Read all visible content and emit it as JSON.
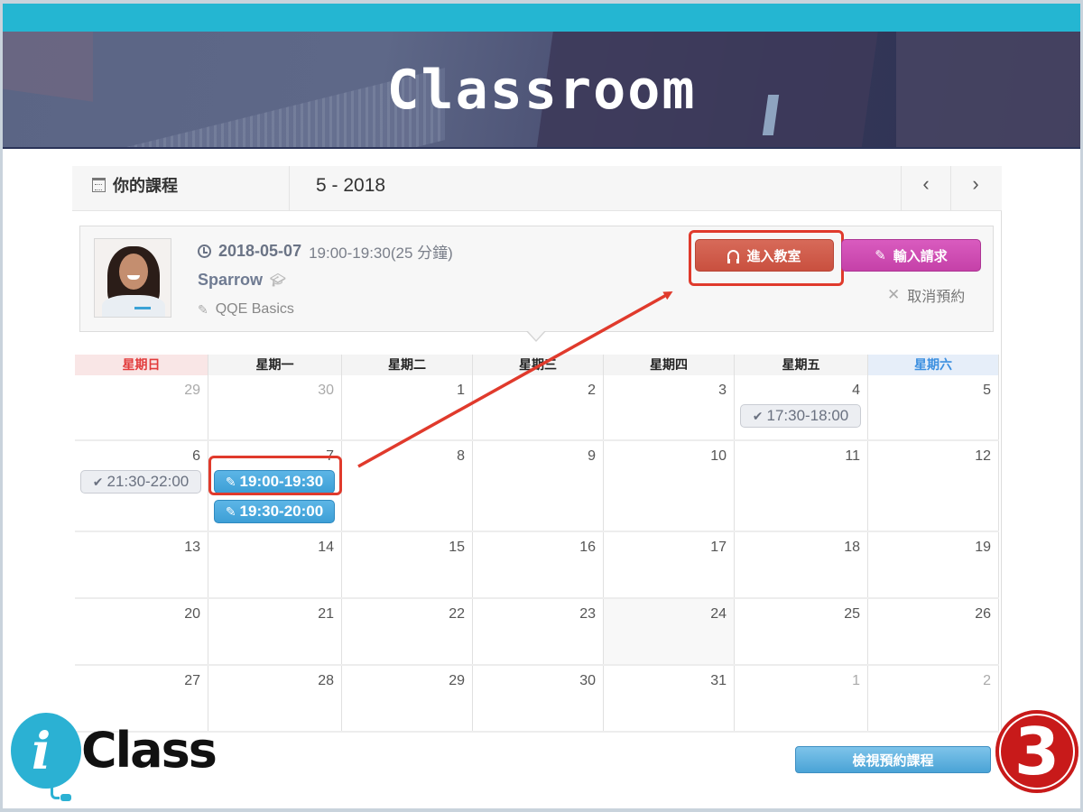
{
  "banner": {
    "title": "Classroom"
  },
  "calendar": {
    "header_title": "你的課程",
    "month_label": "5 - 2018",
    "prev_label": "‹",
    "next_label": "›",
    "weekdays": [
      "星期日",
      "星期一",
      "星期二",
      "星期三",
      "星期四",
      "星期五",
      "星期六"
    ],
    "weeks": [
      [
        {
          "day": "29",
          "other": true
        },
        {
          "day": "30",
          "other": true
        },
        {
          "day": "1"
        },
        {
          "day": "2"
        },
        {
          "day": "3"
        },
        {
          "day": "4",
          "events": [
            {
              "time": "17:30-18:00",
              "status": "done",
              "icon": "check-icon"
            }
          ]
        },
        {
          "day": "5"
        }
      ],
      [
        {
          "day": "6",
          "events": [
            {
              "time": "21:30-22:00",
              "status": "done",
              "icon": "check-icon"
            }
          ]
        },
        {
          "day": "7",
          "events": [
            {
              "time": "19:00-19:30",
              "status": "booked",
              "icon": "pencil-icon"
            },
            {
              "time": "19:30-20:00",
              "status": "booked",
              "icon": "pencil-icon"
            }
          ]
        },
        {
          "day": "8"
        },
        {
          "day": "9"
        },
        {
          "day": "10"
        },
        {
          "day": "11"
        },
        {
          "day": "12"
        }
      ],
      [
        {
          "day": "13"
        },
        {
          "day": "14"
        },
        {
          "day": "15"
        },
        {
          "day": "16"
        },
        {
          "day": "17"
        },
        {
          "day": "18"
        },
        {
          "day": "19"
        }
      ],
      [
        {
          "day": "20"
        },
        {
          "day": "21"
        },
        {
          "day": "22"
        },
        {
          "day": "23"
        },
        {
          "day": "24",
          "today": true
        },
        {
          "day": "25"
        },
        {
          "day": "26"
        }
      ],
      [
        {
          "day": "27"
        },
        {
          "day": "28"
        },
        {
          "day": "29"
        },
        {
          "day": "30"
        },
        {
          "day": "31"
        },
        {
          "day": "1",
          "other": true
        },
        {
          "day": "2",
          "other": true
        }
      ]
    ]
  },
  "lesson": {
    "date": "2018-05-07",
    "time": "19:00-19:30(25 分鐘)",
    "teacher": "Sparrow",
    "course": "QQE Basics",
    "enter_button": "進入教室",
    "request_button": "輸入請求",
    "cancel_button": "取消預約"
  },
  "footer": {
    "logo_text": "Class",
    "logo_i": "i",
    "view_button": "檢視預約課程",
    "step_number": "3"
  },
  "colors": {
    "stripe": "#24b6d2",
    "enter": "#d0594a",
    "request": "#cf4db4",
    "booked_event": "#4aa9dc",
    "highlight": "#e03a2c",
    "sunday": "#e23c3c",
    "saturday": "#3c8fe0"
  }
}
